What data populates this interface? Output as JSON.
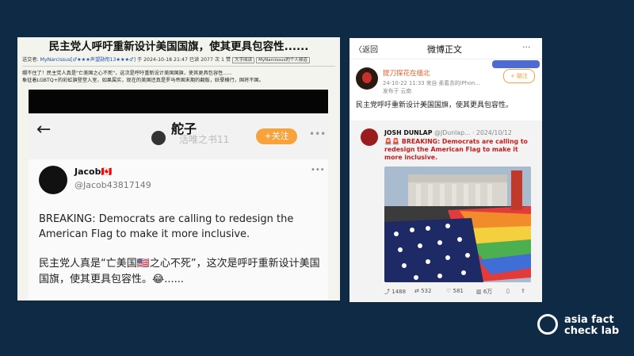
{
  "left": {
    "forum_title": "民主党人呼吁重新设计美国国旗，使其更具包容性......",
    "meta": {
      "sender_label": "送交者:",
      "sender": "MyNarcissus[♂★★★声望勋衔13★★★♂]",
      "date": "于 2024-10-18 21:47 已读 2077 次 1 赞",
      "tag1": "大字阅读",
      "tag2": "MyNarcissus的个人频道"
    },
    "body_lines": [
      "绷不住了！民主党人真是\"亡美国之心不死\"，这次是呼吁重新设计美国国旗，使其更具包容性......",
      "象征着LGBTQ+的彩虹旗登堂入室，如果属实，现在的美国还真是罗马帝国末期的翻版，妖孽横行，国将不国。"
    ],
    "phone": {
      "back_icon": "←",
      "name": "舵子",
      "watermark": "活唯之书11",
      "follow": "+关注",
      "more": "•••",
      "tweet": {
        "name": "Jacob🇨🇦",
        "handle": "@Jacob43817149",
        "text": "BREAKING: Democrats are calling to redesign the American Flag to make it more inclusive.",
        "cn": "民主党人真是“亡美国🇺🇸之心不死”，这次是呼吁重新设计美国国旗，使其更具包容性。😂......",
        "dots": "•••"
      }
    }
  },
  "right": {
    "back": "〈返回",
    "title": "微博正文",
    "more": "···",
    "user": {
      "name": "提刀探花在缅北",
      "date": "24-10-22 11:33 来自 柔着苏的iPhon...",
      "loc": "发布于 云南",
      "follow": "+ 關注"
    },
    "text": "民主党呼吁重新设计美国国旗，使其更具包容性。",
    "tweet": {
      "name": "JOSH DUNLAP",
      "handle": "@JDunlap... · 2024/10/12",
      "text_bold": "BREAKING: Democrats are calling to redesign the American Flag to make it more inclusive.",
      "flags": "🚨🚨"
    },
    "actions": {
      "share": "1488",
      "repost": "532",
      "like": "581",
      "views": "6万"
    }
  },
  "logo": {
    "line1": "asia fact",
    "line2": "check lab"
  }
}
